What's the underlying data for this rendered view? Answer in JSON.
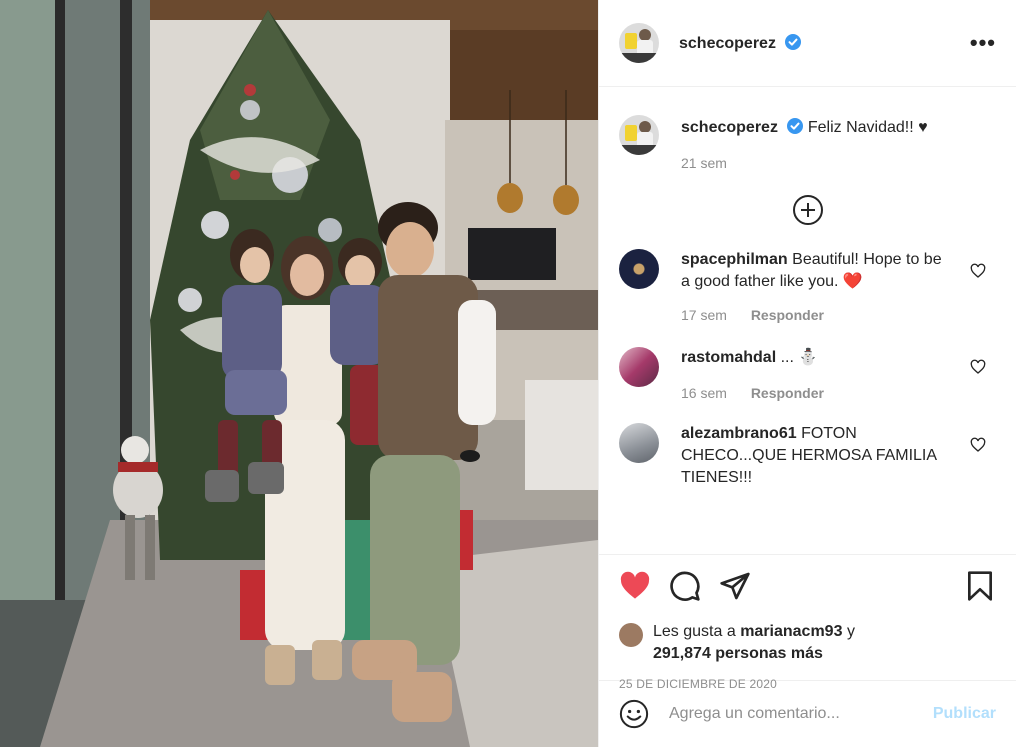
{
  "post": {
    "author": "schecoperez",
    "verified": true,
    "more_label": "•••"
  },
  "caption": {
    "author": "schecoperez",
    "text": "Feliz Navidad!! ♥",
    "time": "21 sem"
  },
  "comments": [
    {
      "author": "spacephilman",
      "text": "Beautiful! Hope to be a good father like you.",
      "emoji": "❤️",
      "time": "17 sem",
      "reply_label": "Responder",
      "avatar_color": "#2b3550"
    },
    {
      "author": "rastomahdal",
      "text": "...",
      "emoji": "⛄",
      "time": "16 sem",
      "reply_label": "Responder",
      "avatar_color": "#b04a74"
    },
    {
      "author": "alezambrano61",
      "text": "FOTON CHECO...QUE HERMOSA FAMILIA TIENES!!!",
      "emoji": "",
      "time": "",
      "reply_label": "",
      "avatar_color": "#8a8f96"
    }
  ],
  "likes": {
    "prefix": "Les gusta a",
    "first_user": "marianacm93",
    "conjunction": "y",
    "others": "291,874 personas más"
  },
  "date": "25 DE DICIEMBRE DE 2020",
  "add_comment": {
    "placeholder": "Agrega un comentario...",
    "post_label": "Publicar"
  },
  "colors": {
    "like_red": "#ed4956",
    "verified_blue": "#3897f0",
    "post_disabled": "#b2dffc"
  }
}
